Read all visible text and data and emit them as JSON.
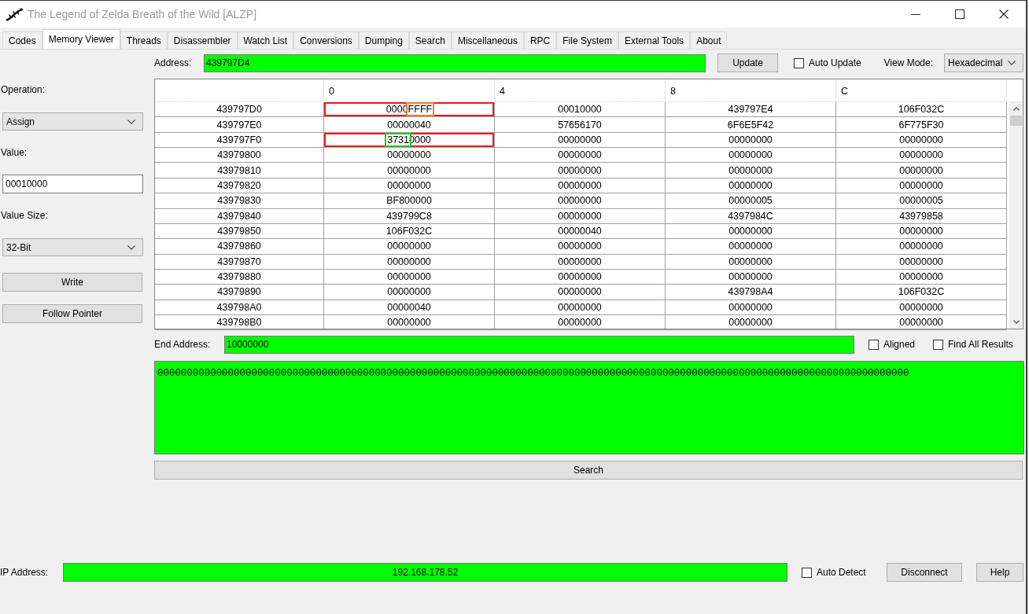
{
  "window": {
    "title": "The Legend of Zelda Breath of the Wild [ALZP]"
  },
  "tabs": [
    {
      "label": "Codes",
      "selected": false
    },
    {
      "label": "Memory Viewer",
      "selected": true
    },
    {
      "label": "Threads",
      "selected": false
    },
    {
      "label": "Disassembler",
      "selected": false
    },
    {
      "label": "Watch List",
      "selected": false
    },
    {
      "label": "Conversions",
      "selected": false
    },
    {
      "label": "Dumping",
      "selected": false
    },
    {
      "label": "Search",
      "selected": false
    },
    {
      "label": "Miscellaneous",
      "selected": false
    },
    {
      "label": "RPC",
      "selected": false
    },
    {
      "label": "File System",
      "selected": false
    },
    {
      "label": "External Tools",
      "selected": false
    },
    {
      "label": "About",
      "selected": false
    }
  ],
  "memory_viewer": {
    "operation": {
      "label": "Operation:",
      "value": "Assign"
    },
    "value": {
      "label": "Value:",
      "value": "00010000"
    },
    "value_size": {
      "label": "Value Size:",
      "value": "32-Bit"
    },
    "side_buttons": [
      "Write",
      "Follow Pointer"
    ],
    "address": {
      "label": "Address:",
      "value": "439797D4"
    },
    "update_button": "Update",
    "auto_update": {
      "label": "Auto Update",
      "checked": false
    },
    "view_mode": {
      "label": "View Mode:",
      "value": "Hexadecimal"
    },
    "table": {
      "columns": [
        "0",
        "4",
        "8",
        "C"
      ],
      "rows": [
        {
          "address": "439797D0",
          "framed": true,
          "cells": [
            {
              "segments": [
                {
                  "text": "0000",
                  "framed": false
                },
                {
                  "text": "FFFF",
                  "framed": true,
                  "color": "#ed7d31"
                }
              ]
            },
            "00010000",
            "439797E4",
            "106F032C"
          ]
        },
        {
          "address": "439797E0",
          "framed": false,
          "cells": [
            "00000040",
            "57656170",
            "6F6E5F42",
            "6F775F30"
          ]
        },
        {
          "address": "439797F0",
          "framed": true,
          "cells": [
            {
              "segments": [
                {
                  "text": "3731",
                  "framed": true,
                  "color": "#1ec81e"
                },
                {
                  "text": "0000",
                  "framed": false
                }
              ]
            },
            "00000000",
            "00000000",
            "00000000"
          ]
        },
        {
          "address": "43979800",
          "framed": false,
          "cells": [
            "00000000",
            "00000000",
            "00000000",
            "00000000"
          ]
        },
        {
          "address": "43979810",
          "framed": false,
          "cells": [
            "00000000",
            "00000000",
            "00000000",
            "00000000"
          ]
        },
        {
          "address": "43979820",
          "framed": false,
          "cells": [
            "00000000",
            "00000000",
            "00000000",
            "00000000"
          ]
        },
        {
          "address": "43979830",
          "framed": false,
          "cells": [
            "BF800000",
            "00000000",
            "00000005",
            "00000005"
          ]
        },
        {
          "address": "43979840",
          "framed": false,
          "cells": [
            "439799C8",
            "00000000",
            "4397984C",
            "43979858"
          ]
        },
        {
          "address": "43979850",
          "framed": false,
          "cells": [
            "106F032C",
            "00000040",
            "00000000",
            "00000000"
          ]
        },
        {
          "address": "43979860",
          "framed": false,
          "cells": [
            "00000000",
            "00000000",
            "00000000",
            "00000000"
          ]
        },
        {
          "address": "43979870",
          "framed": false,
          "cells": [
            "00000000",
            "00000000",
            "00000000",
            "00000000"
          ]
        },
        {
          "address": "43979880",
          "framed": false,
          "cells": [
            "00000000",
            "00000000",
            "00000000",
            "00000000"
          ]
        },
        {
          "address": "43979890",
          "framed": false,
          "cells": [
            "00000000",
            "00000000",
            "439798A4",
            "106F032C"
          ]
        },
        {
          "address": "439798A0",
          "framed": false,
          "cells": [
            "00000040",
            "00000000",
            "00000000",
            "00000000"
          ]
        },
        {
          "address": "439798B0",
          "framed": false,
          "cells": [
            "00000000",
            "00000000",
            "00000000",
            "00000000"
          ]
        }
      ]
    },
    "end_address": {
      "label": "End Address:",
      "value": "10000000"
    },
    "aligned": {
      "label": "Aligned",
      "checked": false
    },
    "find_all_results": {
      "label": "Find All Results",
      "checked": false
    },
    "search_value": "00000000000000000000000000000000000000000000000000000000000000000000000000000000000000000000000000000000000000000000000000000000",
    "search_button": "Search"
  },
  "connection": {
    "ip_address": {
      "label": "IP Address:",
      "value": "192.168.178.52"
    },
    "auto_detect": {
      "label": "Auto Detect",
      "checked": false
    },
    "buttons": [
      "Disconnect",
      "Help"
    ]
  }
}
